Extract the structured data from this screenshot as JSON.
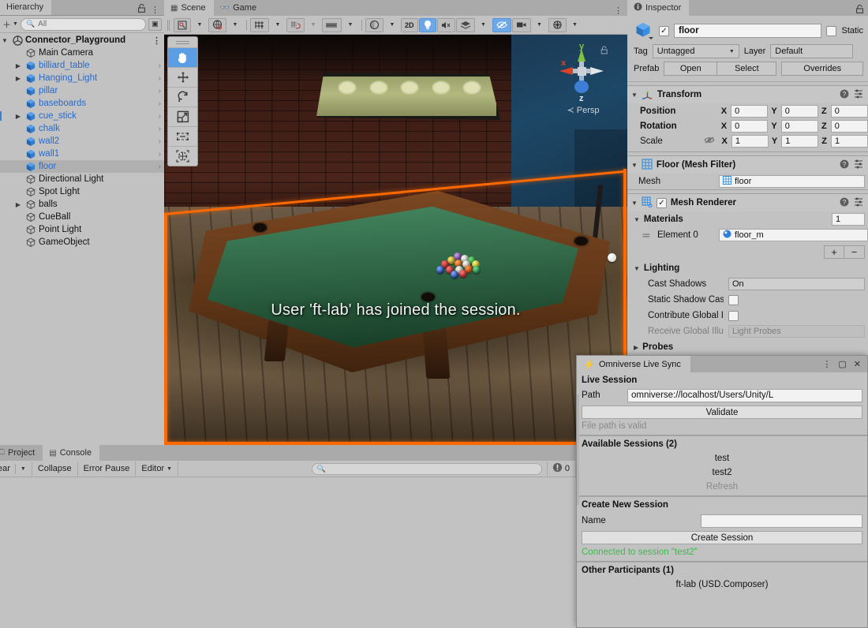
{
  "hierarchy": {
    "tab_label": "Hierarchy",
    "search_placeholder": "All",
    "root": {
      "label": "Connector_Playground",
      "icon": "unity-scene-icon"
    },
    "items": [
      {
        "label": "Main Camera",
        "type": "gameobject",
        "expandable": false,
        "prefab": false,
        "chevron": false,
        "indent": 1
      },
      {
        "label": "billiard_table",
        "type": "prefab",
        "expandable": true,
        "prefab": true,
        "chevron": true,
        "indent": 1
      },
      {
        "label": "Hanging_Light",
        "type": "prefab",
        "expandable": true,
        "prefab": true,
        "chevron": true,
        "indent": 1
      },
      {
        "label": "pillar",
        "type": "prefab",
        "expandable": false,
        "prefab": true,
        "chevron": true,
        "indent": 1
      },
      {
        "label": "baseboards",
        "type": "prefab",
        "expandable": false,
        "prefab": true,
        "chevron": true,
        "indent": 1
      },
      {
        "label": "cue_stick",
        "type": "prefab",
        "expandable": true,
        "prefab": true,
        "chevron": true,
        "indent": 1
      },
      {
        "label": "chalk",
        "type": "prefab",
        "expandable": false,
        "prefab": true,
        "chevron": true,
        "indent": 1
      },
      {
        "label": "wall2",
        "type": "prefab",
        "expandable": false,
        "prefab": true,
        "chevron": true,
        "indent": 1
      },
      {
        "label": "wall1",
        "type": "prefab",
        "expandable": false,
        "prefab": true,
        "chevron": true,
        "indent": 1
      },
      {
        "label": "floor",
        "type": "prefab",
        "expandable": false,
        "prefab": true,
        "chevron": true,
        "indent": 1,
        "selected": true
      },
      {
        "label": "Directional Light",
        "type": "gameobject",
        "expandable": false,
        "prefab": false,
        "chevron": false,
        "indent": 1
      },
      {
        "label": "Spot Light",
        "type": "gameobject",
        "expandable": false,
        "prefab": false,
        "chevron": false,
        "indent": 1
      },
      {
        "label": "balls",
        "type": "gameobject",
        "expandable": true,
        "prefab": false,
        "chevron": false,
        "indent": 1
      },
      {
        "label": "CueBall",
        "type": "gameobject",
        "expandable": false,
        "prefab": false,
        "chevron": false,
        "indent": 1
      },
      {
        "label": "Point Light",
        "type": "gameobject",
        "expandable": false,
        "prefab": false,
        "chevron": false,
        "indent": 1
      },
      {
        "label": "GameObject",
        "type": "gameobject",
        "expandable": false,
        "prefab": false,
        "chevron": false,
        "indent": 1
      }
    ]
  },
  "scene": {
    "tabs": [
      {
        "label": "Scene",
        "icon": "scene-grid-icon",
        "active": true
      },
      {
        "label": "Game",
        "icon": "gamepad-icon",
        "active": false
      }
    ],
    "toolbar": {
      "shading_mode_label": "2D",
      "buttons": [
        {
          "name": "draw-mode-dropdown",
          "icon": "shaded-icon",
          "active": false
        },
        {
          "name": "shading-dropdown",
          "icon": "globe-icon",
          "active": false
        },
        {
          "name": "grid-visibility",
          "icon": "grid-y-icon",
          "active": false
        },
        {
          "name": "snap-increment",
          "icon": "snap-icon",
          "active": false
        },
        {
          "name": "grid-snap",
          "icon": "ruler-icon",
          "active": false
        },
        {
          "name": "gizmo-toggle",
          "icon": "sphere-icon",
          "active": false
        },
        {
          "name": "2d-toggle",
          "icon": "2D",
          "active": false
        },
        {
          "name": "scene-lighting",
          "icon": "lightbulb-icon",
          "active": true
        },
        {
          "name": "scene-audio",
          "icon": "mute-audio-icon",
          "active": false
        },
        {
          "name": "fx-dropdown",
          "icon": "fx-layers-icon",
          "active": false
        },
        {
          "name": "hidden-objects",
          "icon": "eye-slash-icon",
          "active": true
        },
        {
          "name": "camera-settings",
          "icon": "camera-icon",
          "active": false
        },
        {
          "name": "gizmos-dropdown",
          "icon": "gizmo-globe-icon",
          "active": false
        }
      ]
    },
    "tools": [
      {
        "name": "hand-tool",
        "icon": "✋",
        "active": true
      },
      {
        "name": "move-tool",
        "icon": "move-arrows-icon",
        "active": false
      },
      {
        "name": "rotate-tool",
        "icon": "rotate-icon",
        "active": false
      },
      {
        "name": "scale-tool",
        "icon": "scale-icon",
        "active": false
      },
      {
        "name": "rect-tool",
        "icon": "rect-transform-icon",
        "active": false
      },
      {
        "name": "transform-tool",
        "icon": "transform-globe-icon",
        "active": false
      }
    ],
    "gizmo": {
      "x_label": "x",
      "y_label": "y",
      "z_label": "z",
      "projection_label": "Persp",
      "x_color": "#d8432a",
      "y_color": "#7fc241",
      "z_color": "#3d7fd6"
    },
    "overlay_message": "User 'ft-lab' has joined the session.",
    "selection_outline_color": "#ff6a00"
  },
  "console": {
    "tabs": [
      {
        "label": "Project",
        "icon": "folder-icon",
        "active": false
      },
      {
        "label": "Console",
        "icon": "console-icon",
        "active": true
      }
    ],
    "toolbar": {
      "clear_label": "ear",
      "collapse_label": "Collapse",
      "error_pause_label": "Error Pause",
      "editor_label": "Editor",
      "search_placeholder": "",
      "error_count": "0"
    }
  },
  "inspector": {
    "tab_label": "Inspector",
    "object": {
      "enabled": true,
      "name": "floor",
      "static_label": "Static",
      "static_checked": false,
      "tag_label": "Tag",
      "tag_value": "Untagged",
      "layer_label": "Layer",
      "layer_value": "Default",
      "prefab_label": "Prefab",
      "prefab_open": "Open",
      "prefab_select": "Select",
      "prefab_overrides": "Overrides"
    },
    "transform": {
      "title": "Transform",
      "rows": [
        {
          "label": "Position",
          "x": "0",
          "y": "0",
          "z": "0",
          "bold": true
        },
        {
          "label": "Rotation",
          "x": "0",
          "y": "0",
          "z": "0",
          "bold": true
        },
        {
          "label": "Scale",
          "x": "1",
          "y": "1",
          "z": "1",
          "bold": false,
          "link_icon": "constrain-proportions-icon"
        }
      ],
      "axis_x": "X",
      "axis_y": "Y",
      "axis_z": "Z"
    },
    "mesh_filter": {
      "title": "Floor (Mesh Filter)",
      "mesh_label": "Mesh",
      "mesh_value": "floor"
    },
    "mesh_renderer": {
      "title": "Mesh Renderer",
      "enabled": true,
      "materials_label": "Materials",
      "materials_count": "1",
      "element_label": "Element 0",
      "element_value": "floor_m",
      "add_label": "+",
      "remove_label": "−",
      "lighting_label": "Lighting",
      "cast_shadows_label": "Cast Shadows",
      "cast_shadows_value": "On",
      "static_shadow_label": "Static Shadow Cas",
      "static_shadow_checked": false,
      "contribute_gi_label": "Contribute Global I",
      "contribute_gi_checked": false,
      "receive_gi_label": "Receive Global Illu",
      "receive_gi_value": "Light Probes",
      "probes_label": "Probes"
    }
  },
  "omniverse": {
    "title": "Omniverse Live Sync",
    "icon": "lightning-bolt-icon",
    "window_buttons": {
      "menu": "⋮",
      "maximize": "▢",
      "close": "✕"
    },
    "live_session": {
      "header": "Live Session",
      "path_label": "Path",
      "path_value": "omniverse://localhost/Users/Unity/L",
      "validate_label": "Validate",
      "status": "File path is valid"
    },
    "available_sessions": {
      "header": "Available Sessions (2)",
      "items": [
        "test",
        "test2"
      ],
      "refresh_label": "Refresh"
    },
    "create_session": {
      "header": "Create New Session",
      "name_label": "Name",
      "name_value": "",
      "button_label": "Create Session",
      "connected_status": "Connected to session \"test2\"",
      "connected_color": "#3dbb4a"
    },
    "participants": {
      "header": "Other Participants (1)",
      "items": [
        "ft-lab (USD.Composer)"
      ]
    }
  },
  "chart_data": null
}
